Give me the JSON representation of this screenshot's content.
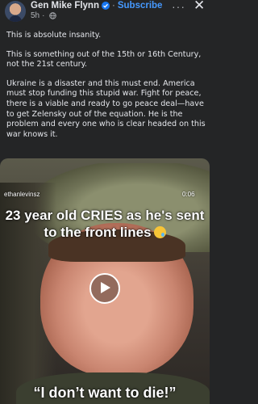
{
  "post": {
    "author": "Gen Mike Flynn",
    "subscribe_label": "Subscribe",
    "separator": "·",
    "time": "5h",
    "more_icon": "···",
    "close_icon": "✕",
    "paragraphs": [
      "This is absolute insanity.",
      "This is something out of the 15th or 16th Century, not the 21st century.",
      "Ukraine is a disaster and this must end. America must stop funding this stupid war. Fight for peace, there is a viable and ready to go peace deal—have to get Zelensky out of the equation. He is the problem and every one who is clear headed on this war knows it."
    ]
  },
  "video": {
    "uploader": "ethanlevinsz",
    "duration": "0:06",
    "caption_top": "23 year old CRIES as he's sent to the front lines",
    "caption_bottom": "“I don’t want to die!”"
  },
  "colors": {
    "background": "#242526",
    "text": "#e4e6eb",
    "secondary": "#b0b3b8",
    "subscribe": "#4599ff",
    "verified": "#1877f2"
  }
}
